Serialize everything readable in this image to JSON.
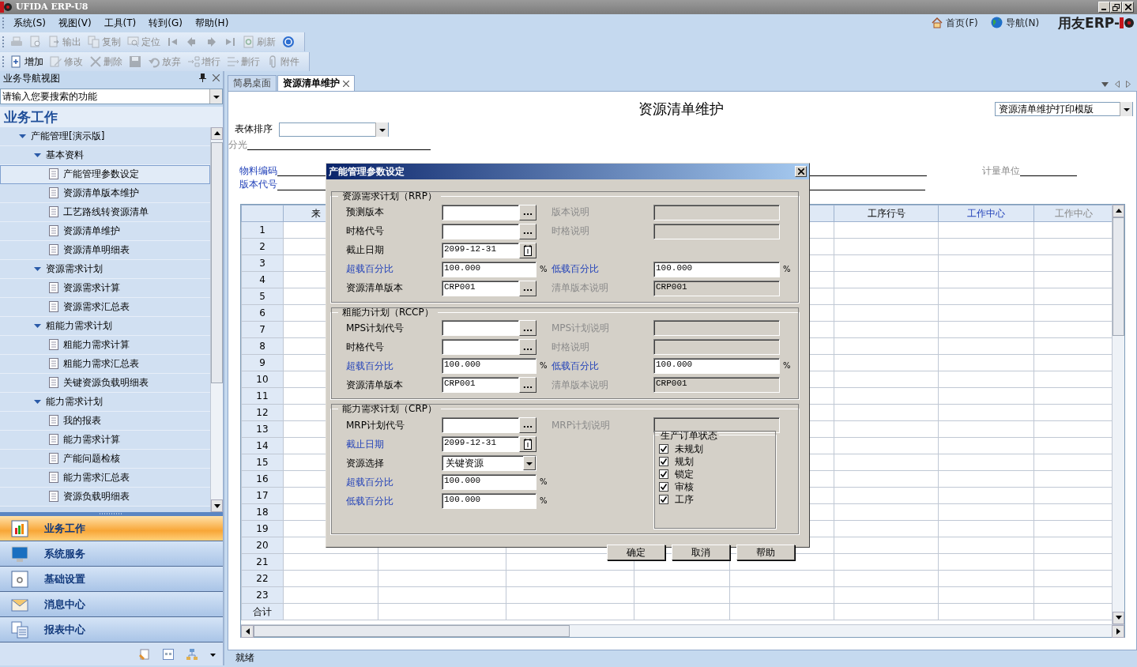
{
  "window": {
    "title": "UFIDA ERP-U8"
  },
  "menu": [
    "系统(S)",
    "视图(V)",
    "工具(T)",
    "转到(G)",
    "帮助(H)"
  ],
  "header_links": [
    {
      "label": "首页(F)",
      "kind": "home"
    },
    {
      "label": "导航(N)",
      "kind": "globe"
    }
  ],
  "brand": "用友ERP-",
  "toolbars": [
    [
      {
        "kind": "print",
        "disabled": true
      },
      {
        "kind": "preview",
        "disabled": true
      },
      {
        "kind": "export",
        "label": "输出",
        "disabled": true
      },
      {
        "kind": "copy",
        "label": "复制",
        "disabled": true
      },
      {
        "kind": "locate",
        "label": "定位",
        "disabled": true
      },
      {
        "kind": "first",
        "disabled": true
      },
      {
        "kind": "prev",
        "disabled": true
      },
      {
        "kind": "next",
        "disabled": true
      },
      {
        "kind": "last",
        "disabled": true
      },
      {
        "kind": "refresh",
        "label": "刷新",
        "disabled": true
      },
      {
        "kind": "help",
        "disabled": false
      }
    ],
    [
      {
        "kind": "add",
        "label": "增加",
        "disabled": false
      },
      {
        "kind": "edit",
        "label": "修改",
        "disabled": true
      },
      {
        "kind": "delete",
        "label": "删除",
        "disabled": true
      },
      {
        "kind": "save",
        "disabled": true
      },
      {
        "kind": "discard",
        "label": "放弃",
        "disabled": true
      },
      {
        "kind": "add-row",
        "label": "增行",
        "disabled": true
      },
      {
        "kind": "delete-row",
        "label": "删行",
        "disabled": true
      },
      {
        "kind": "attach",
        "label": "附件",
        "disabled": true
      }
    ]
  ],
  "nav": {
    "title": "业务导航视图",
    "search_placeholder": "请输入您要搜索的功能",
    "heading": "业务工作",
    "tree": [
      {
        "label": "产能管理[演示版]",
        "expanded": true,
        "children": [
          {
            "label": "基本资料",
            "expanded": true,
            "children": [
              {
                "label": "产能管理参数设定",
                "selected": true
              },
              {
                "label": "资源清单版本维护",
                "selected": false
              },
              {
                "label": "工艺路线转资源清单",
                "selected": false
              },
              {
                "label": "资源清单维护",
                "selected": false
              },
              {
                "label": "资源清单明细表",
                "selected": false
              }
            ]
          },
          {
            "label": "资源需求计划",
            "expanded": true,
            "children": [
              {
                "label": "资源需求计算",
                "selected": false
              },
              {
                "label": "资源需求汇总表",
                "selected": false
              }
            ]
          },
          {
            "label": "粗能力需求计划",
            "expanded": true,
            "children": [
              {
                "label": "粗能力需求计算",
                "selected": false
              },
              {
                "label": "粗能力需求汇总表",
                "selected": false
              },
              {
                "label": "关键资源负载明细表",
                "selected": false
              }
            ]
          },
          {
            "label": "能力需求计划",
            "expanded": true,
            "children": [
              {
                "label": "我的报表",
                "selected": false
              },
              {
                "label": "能力需求计算",
                "selected": false
              },
              {
                "label": "产能问题检核",
                "selected": false
              },
              {
                "label": "能力需求汇总表",
                "selected": false
              },
              {
                "label": "资源负载明细表",
                "selected": false
              }
            ]
          }
        ]
      }
    ],
    "sections": [
      {
        "label": "业务工作",
        "selected": true
      },
      {
        "label": "系统服务",
        "selected": false
      },
      {
        "label": "基础设置",
        "selected": false
      },
      {
        "label": "消息中心",
        "selected": false
      },
      {
        "label": "报表中心",
        "selected": false
      }
    ]
  },
  "tabs": [
    {
      "label": "简易桌面",
      "selected": false,
      "closable": false
    },
    {
      "label": "资源清单维护",
      "selected": true,
      "closable": true
    }
  ],
  "form": {
    "title": "资源清单维护",
    "print_template": "资源清单维护打印模版",
    "sort_label": "表体排序",
    "field_rows": [
      [
        {
          "label": "分光",
          "required": false,
          "disabled": true
        }
      ],
      [
        {
          "label": "物料编码",
          "required": true,
          "disabled": false
        },
        {
          "label": "计量单位",
          "required": false,
          "disabled": true
        }
      ],
      [
        {
          "label": "版本代号",
          "required": true,
          "disabled": false
        }
      ]
    ],
    "table": {
      "columns": [
        null,
        {
          "label": "来",
          "required": false,
          "disabled": false
        },
        null,
        null,
        null,
        null,
        {
          "label": "工序行号",
          "required": false,
          "disabled": false
        },
        {
          "label": "工作中心",
          "required": true,
          "disabled": false
        },
        {
          "label": "工作中心",
          "required": false,
          "disabled": true
        }
      ],
      "rows": [
        "1",
        "2",
        "3",
        "4",
        "5",
        "6",
        "7",
        "8",
        "9",
        "10",
        "11",
        "12",
        "13",
        "14",
        "15",
        "16",
        "17",
        "18",
        "19",
        "20",
        "21",
        "22",
        "23"
      ],
      "total_label": "合计"
    }
  },
  "dialog": {
    "title": "产能管理参数设定",
    "groups": [
      {
        "title": "资源需求计划（RRP）",
        "rows": [
          {
            "left": {
              "label": "预测版本",
              "required": false,
              "kind": "lookup",
              "button": "..."
            },
            "right": {
              "label": "版本说明",
              "required": false,
              "disabled": true,
              "kind": "readonly"
            }
          },
          {
            "left": {
              "label": "时格代号",
              "required": false,
              "kind": "lookup",
              "button": "..."
            },
            "right": {
              "label": "时格说明",
              "required": false,
              "disabled": true,
              "kind": "readonly"
            }
          },
          {
            "left": {
              "label": "截止日期",
              "required": false,
              "kind": "date",
              "value": "2099-12-31"
            }
          },
          {
            "left": {
              "label": "超载百分比",
              "required": true,
              "kind": "number",
              "value": "100.000",
              "unit": "%"
            },
            "right": {
              "label": "低载百分比",
              "required": true,
              "disabled": false,
              "kind": "number",
              "value": "100.000",
              "unit": "%"
            }
          },
          {
            "left": {
              "label": "资源清单版本",
              "required": false,
              "kind": "lookup",
              "value": "CRP001",
              "button": "..."
            },
            "right": {
              "label": "清单版本说明",
              "required": false,
              "disabled": true,
              "kind": "readonly",
              "value": "CRP001"
            }
          }
        ]
      },
      {
        "title": "粗能力计划（RCCP）",
        "rows": [
          {
            "left": {
              "label": "MPS计划代号",
              "required": false,
              "kind": "lookup",
              "button": "..."
            },
            "right": {
              "label": "MPS计划说明",
              "required": false,
              "disabled": true,
              "kind": "readonly"
            }
          },
          {
            "left": {
              "label": "时格代号",
              "required": false,
              "kind": "lookup",
              "button": "..."
            },
            "right": {
              "label": "时格说明",
              "required": false,
              "disabled": true,
              "kind": "readonly"
            }
          },
          {
            "left": {
              "label": "超载百分比",
              "required": true,
              "kind": "number",
              "value": "100.000",
              "unit": "%"
            },
            "right": {
              "label": "低载百分比",
              "required": true,
              "disabled": false,
              "kind": "number",
              "value": "100.000",
              "unit": "%"
            }
          },
          {
            "left": {
              "label": "资源清单版本",
              "required": false,
              "kind": "lookup",
              "value": "CRP001",
              "button": "..."
            },
            "right": {
              "label": "清单版本说明",
              "required": false,
              "disabled": true,
              "kind": "readonly",
              "value": "CRP001"
            }
          }
        ]
      },
      {
        "title": "能力需求计划（CRP）",
        "rows": [
          {
            "left": {
              "label": "MRP计划代号",
              "required": false,
              "kind": "lookup",
              "button": "..."
            },
            "right": {
              "label": "MRP计划说明",
              "required": false,
              "disabled": true,
              "kind": "readonly"
            }
          },
          {
            "left": {
              "label": "截止日期",
              "required": true,
              "kind": "date",
              "value": "2099-12-31"
            }
          },
          {
            "left": {
              "label": "资源选择",
              "required": false,
              "kind": "select",
              "value": "关键资源"
            }
          },
          {
            "left": {
              "label": "超载百分比",
              "required": true,
              "kind": "number",
              "value": "100.000",
              "unit": "%"
            }
          },
          {
            "left": {
              "label": "低载百分比",
              "required": true,
              "kind": "number",
              "value": "100.000",
              "unit": "%"
            }
          }
        ],
        "status": {
          "title": "生产订单状态",
          "options": [
            {
              "label": "未规划",
              "checked": true
            },
            {
              "label": "规划",
              "checked": true
            },
            {
              "label": "锁定",
              "checked": true
            },
            {
              "label": "审核",
              "checked": true
            },
            {
              "label": "工序",
              "checked": true
            }
          ]
        }
      }
    ],
    "buttons": [
      "确定",
      "取消",
      "帮助"
    ]
  },
  "status_bar": "就绪"
}
